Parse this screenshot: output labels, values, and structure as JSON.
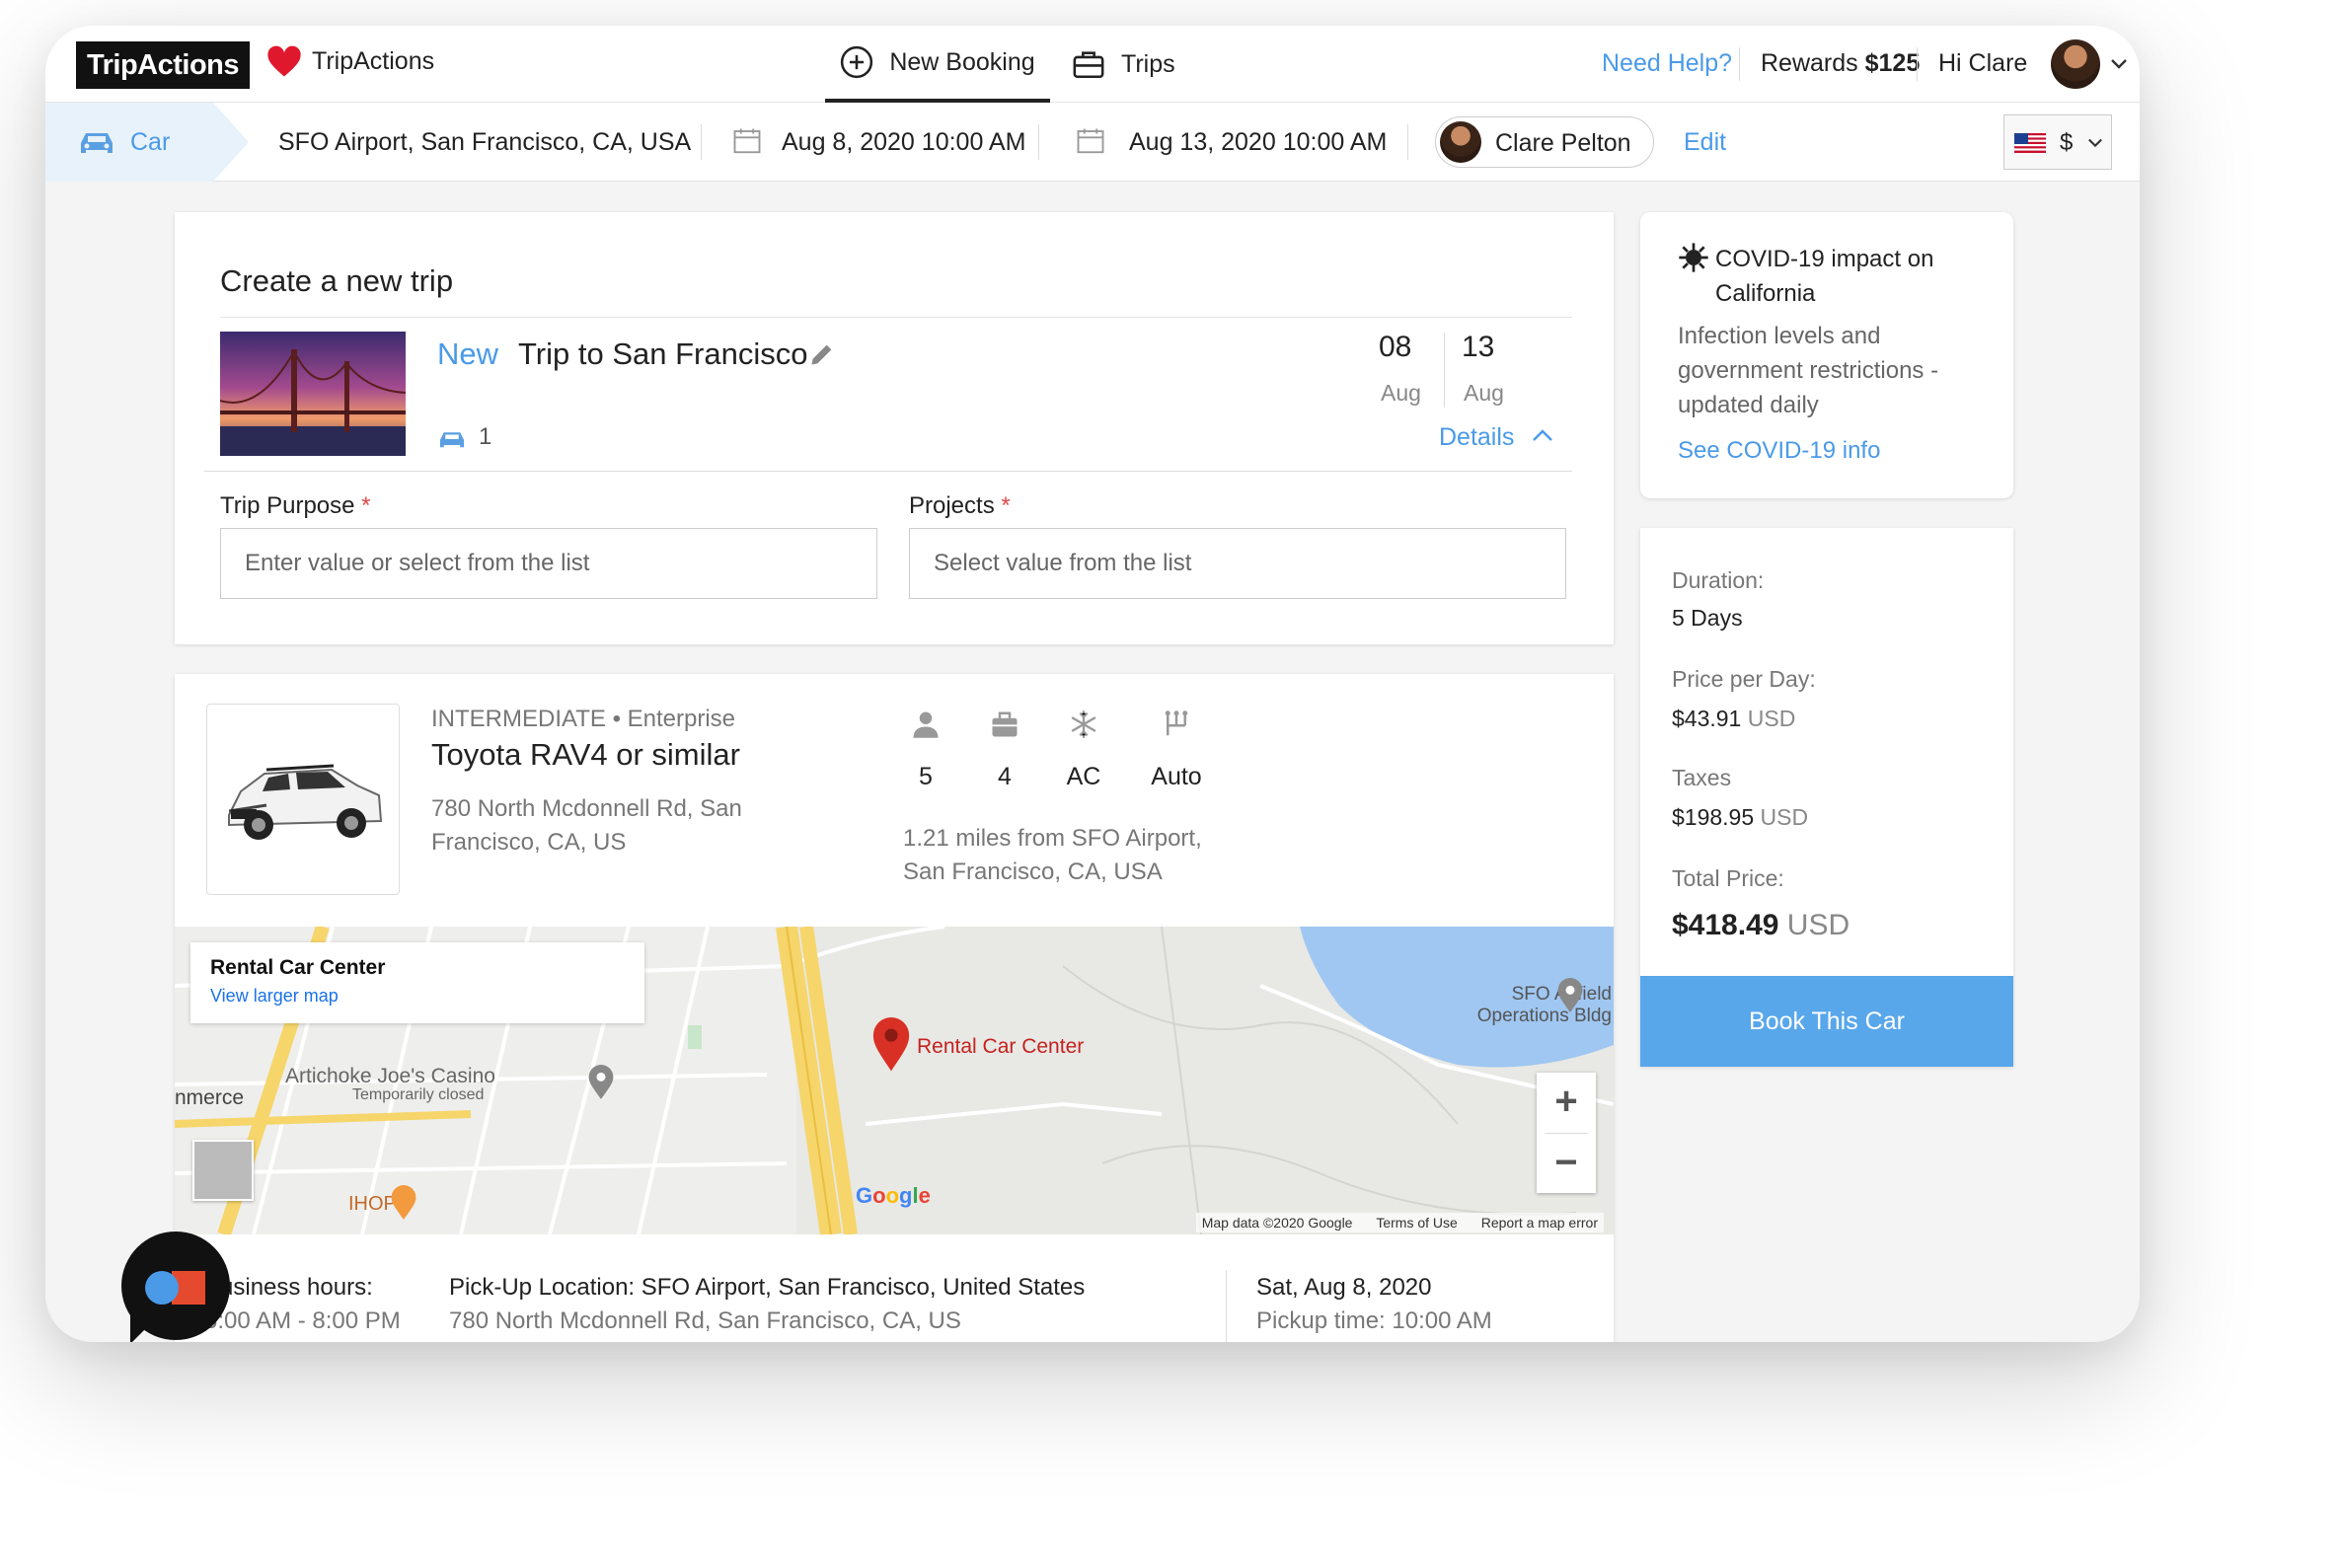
{
  "nav": {
    "logo": "TripActions",
    "brand": "TripActions",
    "new_booking": "New Booking",
    "trips": "Trips",
    "need_help": "Need Help?",
    "rewards_label": "Rewards",
    "rewards_value": "$125",
    "greeting": "Hi Clare"
  },
  "search": {
    "mode": "Car",
    "location": "SFO Airport, San Francisco, CA, USA",
    "pickup": "Aug 8, 2020 10:00 AM",
    "dropoff": "Aug 13, 2020 10:00 AM",
    "traveler": "Clare Pelton",
    "edit": "Edit",
    "currency": "$"
  },
  "trip": {
    "heading": "Create a new trip",
    "tag": "New",
    "name": "Trip to San Francisco",
    "car_count": "1",
    "start_day": "08",
    "start_month": "Aug",
    "end_day": "13",
    "end_month": "Aug",
    "details": "Details",
    "purpose_label": "Trip Purpose",
    "purpose_placeholder": "Enter value or select from the list",
    "projects_label": "Projects",
    "projects_placeholder": "Select value from the list",
    "required_mark": "*"
  },
  "car": {
    "class": "INTERMEDIATE • Enterprise",
    "model": "Toyota RAV4 or similar",
    "address": "780 North Mcdonnell Rd, San Francisco, CA, US",
    "seats": "5",
    "bags": "4",
    "ac": "AC",
    "transmission": "Auto",
    "distance": "1.21 miles from SFO Airport, San Francisco, CA, USA"
  },
  "map": {
    "popup_title": "Rental Car Center",
    "popup_link": "View larger map",
    "pin_label": "Rental Car Center",
    "poi_casino": "Artichoke Joe's Casino",
    "poi_casino_sub": "Temporarily closed",
    "poi_ihop": "IHOP",
    "poi_sfo": "SFO Airfield Operations Bldg",
    "area_label": "nmerce",
    "google": "Google",
    "zoom_in": "+",
    "zoom_out": "−",
    "footer_data": "Map data ©2020 Google",
    "footer_terms": "Terms of Use",
    "footer_report": "Report a map error"
  },
  "pickup_info": {
    "hours_label": "Business hours:",
    "hours_value": "6:00 AM - 8:00 PM",
    "location_label": "Pick-Up Location: SFO Airport, San Francisco, United States",
    "location_value": "780 North Mcdonnell Rd, San Francisco, CA, US",
    "date_label": "Sat, Aug 8, 2020",
    "date_value": "Pickup time: 10:00 AM"
  },
  "covid": {
    "title": "COVID-19 impact on California",
    "body": "Infection levels and government restrictions - updated daily",
    "link": "See COVID-19 info"
  },
  "price": {
    "duration_label": "Duration:",
    "duration_value": "5 Days",
    "per_day_label": "Price per Day:",
    "per_day_value": "$43.91",
    "taxes_label": "Taxes",
    "taxes_value": "$198.95",
    "total_label": "Total Price:",
    "total_value": "$418.49",
    "currency_code": "USD",
    "book_button": "Book This Car"
  },
  "colors": {
    "accent": "#4a9ae8",
    "book_button": "#58a7eb",
    "required": "#e04848"
  }
}
